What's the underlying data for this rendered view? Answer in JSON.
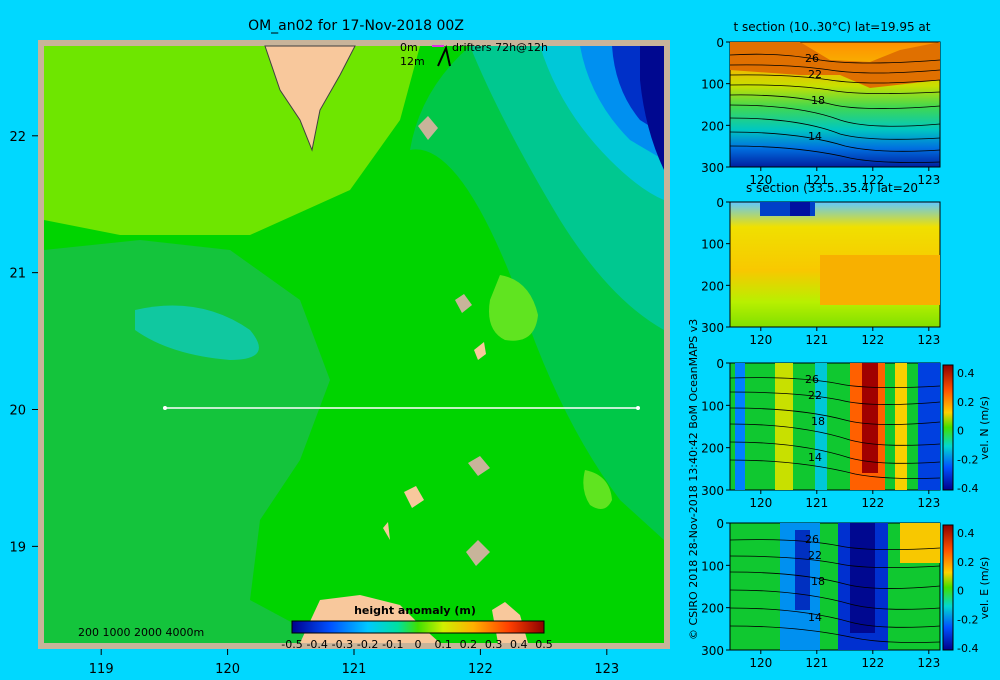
{
  "colors": {
    "background": "#00d8ff",
    "land": "#f8c89c",
    "frame": "#c8b49a",
    "transect": "#ffffff",
    "drifter": "#e030e0"
  },
  "chart_data": [
    {
      "type": "heatmap",
      "title": "OM_an02 for 17-Nov-2018 00Z",
      "x_ticks": [
        "119",
        "120",
        "121",
        "122",
        "123"
      ],
      "y_ticks": [
        "22",
        "21",
        "20",
        "19"
      ],
      "xlim": [
        118.5,
        123.5
      ],
      "ylim": [
        18.25,
        22.7
      ],
      "transect": {
        "lat": 20,
        "lon_start": 119.5,
        "lon_end": 123.2
      },
      "legend_lines": [
        "0m",
        "drifters 72h@12h",
        "12m"
      ],
      "bathymetry_label": "200  1000  2000  4000m",
      "colorbar": {
        "label": "height anomaly (m)",
        "ticks": [
          "-0.5",
          "-0.4",
          "-0.3",
          "-0.2",
          "-0.1",
          "0",
          "0.1",
          "0.2",
          "0.3",
          "0.4",
          "0.5"
        ],
        "range": [
          -0.5,
          0.5
        ]
      }
    },
    {
      "type": "heatmap",
      "title": "t section (10..30°C) lat=19.95 at",
      "x_ticks": [
        "120",
        "121",
        "122",
        "123"
      ],
      "y_ticks": [
        "0",
        "100",
        "200",
        "300"
      ],
      "contour_labels": [
        "26",
        "22",
        "18",
        "14"
      ]
    },
    {
      "type": "heatmap",
      "title": "s section (33.5..35.4) lat=20",
      "x_ticks": [
        "120",
        "121",
        "122",
        "123"
      ],
      "y_ticks": [
        "0",
        "100",
        "200",
        "300"
      ]
    },
    {
      "type": "heatmap",
      "title": "",
      "x_ticks": [
        "120",
        "121",
        "122",
        "123"
      ],
      "y_ticks": [
        "0",
        "100",
        "200",
        "300"
      ],
      "contour_labels": [
        "26",
        "22",
        "18",
        "14"
      ],
      "colorbar": {
        "label": "vel. N (m/s)",
        "ticks": [
          "0.4",
          "0.2",
          "0",
          "-0.2",
          "-0.4"
        ]
      }
    },
    {
      "type": "heatmap",
      "title": "",
      "x_ticks": [
        "120",
        "121",
        "122",
        "123"
      ],
      "y_ticks": [
        "0",
        "100",
        "200",
        "300"
      ],
      "contour_labels": [
        "26",
        "22",
        "18",
        "14"
      ],
      "colorbar": {
        "label": "vel. E (m/s)",
        "ticks": [
          "0.4",
          "0.2",
          "0",
          "-0.2",
          "-0.4"
        ]
      }
    }
  ],
  "credit": "© CSIRO 2018  28-Nov-2018 13:40:42 BoM OceanMAPS v3"
}
